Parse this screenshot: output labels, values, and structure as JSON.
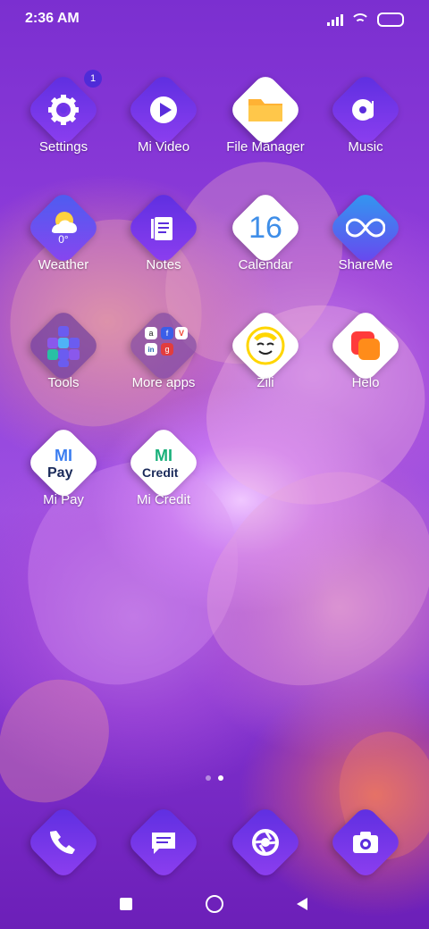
{
  "status": {
    "time": "2:36 AM"
  },
  "apps": [
    {
      "label": "Settings",
      "icon": "gear-icon",
      "badge": "1"
    },
    {
      "label": "Mi Video",
      "icon": "play-icon"
    },
    {
      "label": "File Manager",
      "icon": "folder-icon"
    },
    {
      "label": "Music",
      "icon": "music-icon"
    },
    {
      "label": "Weather",
      "icon": "weather-icon",
      "temp": "0°"
    },
    {
      "label": "Notes",
      "icon": "notes-icon"
    },
    {
      "label": "Calendar",
      "icon": "calendar-icon",
      "date": "16"
    },
    {
      "label": "ShareMe",
      "icon": "shareme-icon"
    },
    {
      "label": "Tools",
      "icon": "tools-folder-icon"
    },
    {
      "label": "More apps",
      "icon": "more-apps-folder-icon"
    },
    {
      "label": "Zili",
      "icon": "zili-icon"
    },
    {
      "label": "Helo",
      "icon": "helo-icon"
    },
    {
      "label": "Mi Pay",
      "icon": "mi-pay-icon"
    },
    {
      "label": "Mi Credit",
      "icon": "mi-credit-icon"
    }
  ],
  "more_apps_glyphs": [
    "a",
    "f",
    "V",
    "in",
    "g"
  ],
  "page_indicator": {
    "count": 2,
    "active": 2
  },
  "dock": [
    {
      "name": "Phone",
      "icon": "phone-icon"
    },
    {
      "name": "Messages",
      "icon": "messages-icon"
    },
    {
      "name": "Browser",
      "icon": "browser-icon"
    },
    {
      "name": "Camera",
      "icon": "camera-icon"
    }
  ],
  "navbar": [
    {
      "name": "recents",
      "icon": "square-icon"
    },
    {
      "name": "home",
      "icon": "circle-icon"
    },
    {
      "name": "back",
      "icon": "back-icon"
    }
  ]
}
